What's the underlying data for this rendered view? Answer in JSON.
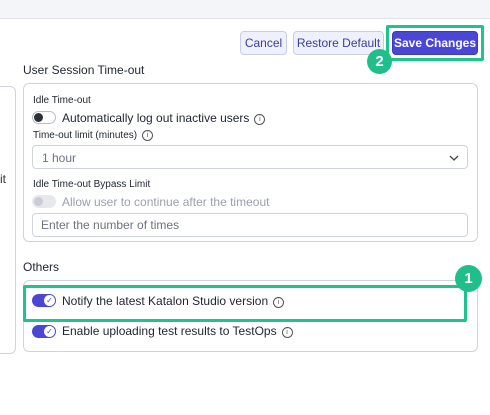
{
  "left_fragment": "it",
  "toolbar": {
    "cancel_label": "Cancel",
    "restore_label": "Restore Default",
    "save_label": "Save Changes"
  },
  "session": {
    "title": "User Session Time-out",
    "idle_label": "Idle Time-out",
    "auto_logout_label": "Automatically log out inactive users",
    "limit_label": "Time-out limit (minutes)",
    "limit_value": "1 hour",
    "bypass_label": "Idle Time-out Bypass Limit",
    "allow_label": "Allow user to continue after the timeout",
    "bypass_placeholder": "Enter the number of times"
  },
  "others": {
    "title": "Others",
    "notify_label": "Notify the latest Katalon Studio version",
    "notify_on": true,
    "upload_label": "Enable uploading test results to TestOps",
    "upload_on": true
  },
  "annotations": {
    "step1": "1",
    "step2": "2",
    "highlight_color": "#1fc38e"
  },
  "colors": {
    "primary": "#4a47d6",
    "annotation": "#1fbf8a"
  },
  "icons": [
    "info-icon",
    "chevron-down-icon",
    "check-icon"
  ]
}
